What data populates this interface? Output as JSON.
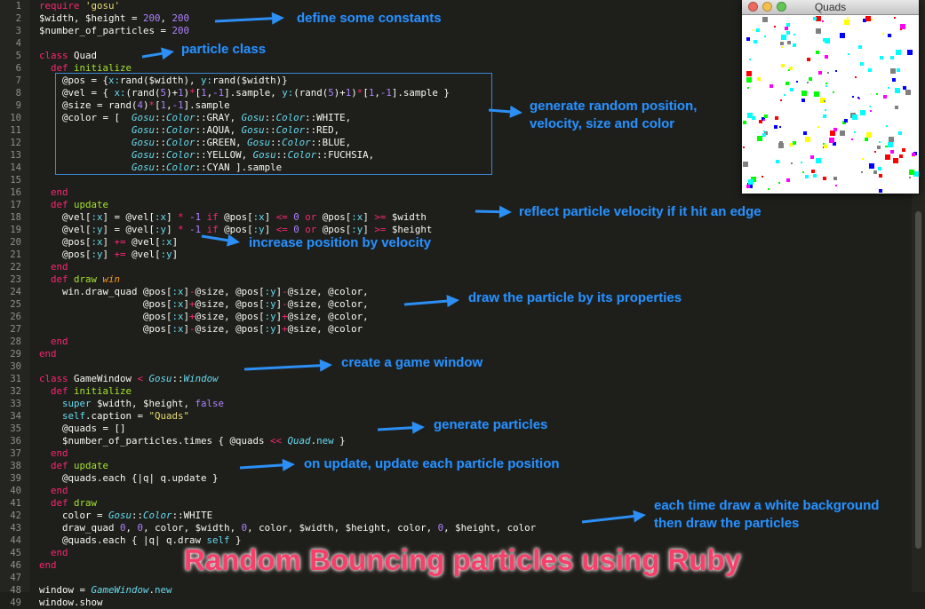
{
  "code_lines": [
    [
      [
        "kw",
        "require "
      ],
      [
        "str",
        "'gosu'"
      ]
    ],
    [
      [
        "iv",
        "$width, $height = "
      ],
      [
        "num",
        "200"
      ],
      [
        "iv",
        ", "
      ],
      [
        "num",
        "200"
      ]
    ],
    [
      [
        "iv",
        "$number_of_particles = "
      ],
      [
        "num",
        "200"
      ]
    ],
    [
      [
        "iv",
        ""
      ]
    ],
    [
      [
        "kw",
        "class "
      ],
      [
        "iv",
        "Quad"
      ]
    ],
    [
      [
        "iv",
        "  "
      ],
      [
        "kw",
        "def "
      ],
      [
        "fn",
        "initialize"
      ]
    ],
    [
      [
        "iv",
        "    @pos = {"
      ],
      [
        "sym",
        "x:"
      ],
      [
        "iv",
        "rand($width), "
      ],
      [
        "sym",
        "y:"
      ],
      [
        "iv",
        "rand($width)}"
      ]
    ],
    [
      [
        "iv",
        "    @vel = { "
      ],
      [
        "sym",
        "x:"
      ],
      [
        "iv",
        "(rand("
      ],
      [
        "num",
        "5"
      ],
      [
        "iv",
        ")+"
      ],
      [
        "num",
        "1"
      ],
      [
        "iv",
        ")"
      ],
      [
        "kw",
        "*"
      ],
      [
        "iv",
        "["
      ],
      [
        "num",
        "1"
      ],
      [
        "iv",
        ","
      ],
      [
        "num",
        "-1"
      ],
      [
        "iv",
        "].sample, "
      ],
      [
        "sym",
        "y:"
      ],
      [
        "iv",
        "(rand("
      ],
      [
        "num",
        "5"
      ],
      [
        "iv",
        ")+"
      ],
      [
        "num",
        "1"
      ],
      [
        "iv",
        ")"
      ],
      [
        "kw",
        "*"
      ],
      [
        "iv",
        "["
      ],
      [
        "num",
        "1"
      ],
      [
        "iv",
        ","
      ],
      [
        "num",
        "-1"
      ],
      [
        "iv",
        "].sample }"
      ]
    ],
    [
      [
        "iv",
        "    @size = rand("
      ],
      [
        "num",
        "4"
      ],
      [
        "iv",
        ")"
      ],
      [
        "kw",
        "*"
      ],
      [
        "iv",
        "["
      ],
      [
        "num",
        "1"
      ],
      [
        "iv",
        ","
      ],
      [
        "num",
        "-1"
      ],
      [
        "iv",
        "].sample"
      ]
    ],
    [
      [
        "iv",
        "    @color = [  "
      ],
      [
        "cn",
        "Gosu"
      ],
      [
        "iv",
        "::"
      ],
      [
        "cn",
        "Color"
      ],
      [
        "iv",
        "::GRAY, "
      ],
      [
        "cn",
        "Gosu"
      ],
      [
        "iv",
        "::"
      ],
      [
        "cn",
        "Color"
      ],
      [
        "iv",
        "::WHITE,"
      ]
    ],
    [
      [
        "iv",
        "                "
      ],
      [
        "cn",
        "Gosu"
      ],
      [
        "iv",
        "::"
      ],
      [
        "cn",
        "Color"
      ],
      [
        "iv",
        "::AQUA, "
      ],
      [
        "cn",
        "Gosu"
      ],
      [
        "iv",
        "::"
      ],
      [
        "cn",
        "Color"
      ],
      [
        "iv",
        "::RED,"
      ]
    ],
    [
      [
        "iv",
        "                "
      ],
      [
        "cn",
        "Gosu"
      ],
      [
        "iv",
        "::"
      ],
      [
        "cn",
        "Color"
      ],
      [
        "iv",
        "::GREEN, "
      ],
      [
        "cn",
        "Gosu"
      ],
      [
        "iv",
        "::"
      ],
      [
        "cn",
        "Color"
      ],
      [
        "iv",
        "::BLUE,"
      ]
    ],
    [
      [
        "iv",
        "                "
      ],
      [
        "cn",
        "Gosu"
      ],
      [
        "iv",
        "::"
      ],
      [
        "cn",
        "Color"
      ],
      [
        "iv",
        "::YELLOW, "
      ],
      [
        "cn",
        "Gosu"
      ],
      [
        "iv",
        "::"
      ],
      [
        "cn",
        "Color"
      ],
      [
        "iv",
        "::FUCHSIA,"
      ]
    ],
    [
      [
        "iv",
        "                "
      ],
      [
        "cn",
        "Gosu"
      ],
      [
        "iv",
        "::"
      ],
      [
        "cn",
        "Color"
      ],
      [
        "iv",
        "::CYAN ].sample"
      ]
    ],
    [
      [
        "iv",
        ""
      ]
    ],
    [
      [
        "iv",
        "  "
      ],
      [
        "kw",
        "end"
      ]
    ],
    [
      [
        "iv",
        "  "
      ],
      [
        "kw",
        "def "
      ],
      [
        "fn",
        "update"
      ]
    ],
    [
      [
        "iv",
        "    @vel["
      ],
      [
        "sym",
        ":x"
      ],
      [
        "iv",
        "] = @vel["
      ],
      [
        "sym",
        ":x"
      ],
      [
        "iv",
        "] "
      ],
      [
        "kw",
        "*"
      ],
      [
        "iv",
        " "
      ],
      [
        "num",
        "-1"
      ],
      [
        "iv",
        " "
      ],
      [
        "kw",
        "if"
      ],
      [
        "iv",
        " @pos["
      ],
      [
        "sym",
        ":x"
      ],
      [
        "iv",
        "] "
      ],
      [
        "kw",
        "<="
      ],
      [
        "iv",
        " "
      ],
      [
        "num",
        "0"
      ],
      [
        "iv",
        " "
      ],
      [
        "kw",
        "or"
      ],
      [
        "iv",
        " @pos["
      ],
      [
        "sym",
        ":x"
      ],
      [
        "iv",
        "] "
      ],
      [
        "kw",
        ">="
      ],
      [
        "iv",
        " $width"
      ]
    ],
    [
      [
        "iv",
        "    @vel["
      ],
      [
        "sym",
        ":y"
      ],
      [
        "iv",
        "] = @vel["
      ],
      [
        "sym",
        ":y"
      ],
      [
        "iv",
        "] "
      ],
      [
        "kw",
        "*"
      ],
      [
        "iv",
        " "
      ],
      [
        "num",
        "-1"
      ],
      [
        "iv",
        " "
      ],
      [
        "kw",
        "if"
      ],
      [
        "iv",
        " @pos["
      ],
      [
        "sym",
        ":y"
      ],
      [
        "iv",
        "] "
      ],
      [
        "kw",
        "<="
      ],
      [
        "iv",
        " "
      ],
      [
        "num",
        "0"
      ],
      [
        "iv",
        " "
      ],
      [
        "kw",
        "or"
      ],
      [
        "iv",
        " @pos["
      ],
      [
        "sym",
        ":y"
      ],
      [
        "iv",
        "] "
      ],
      [
        "kw",
        ">="
      ],
      [
        "iv",
        " $height"
      ]
    ],
    [
      [
        "iv",
        "    @pos["
      ],
      [
        "sym",
        ":x"
      ],
      [
        "iv",
        "] "
      ],
      [
        "kw",
        "+="
      ],
      [
        "iv",
        " @vel["
      ],
      [
        "sym",
        ":x"
      ],
      [
        "iv",
        "]"
      ]
    ],
    [
      [
        "iv",
        "    @pos["
      ],
      [
        "sym",
        ":y"
      ],
      [
        "iv",
        "] "
      ],
      [
        "kw",
        "+="
      ],
      [
        "iv",
        " @vel["
      ],
      [
        "sym",
        ":y"
      ],
      [
        "iv",
        "]"
      ]
    ],
    [
      [
        "iv",
        "  "
      ],
      [
        "kw",
        "end"
      ]
    ],
    [
      [
        "iv",
        "  "
      ],
      [
        "kw",
        "def "
      ],
      [
        "fn",
        "draw "
      ],
      [
        "pm",
        "win"
      ]
    ],
    [
      [
        "iv",
        "    win.draw_quad @pos["
      ],
      [
        "sym",
        ":x"
      ],
      [
        "iv",
        "]"
      ],
      [
        "kw",
        "-"
      ],
      [
        "iv",
        "@size, @pos["
      ],
      [
        "sym",
        ":y"
      ],
      [
        "iv",
        "]"
      ],
      [
        "kw",
        "-"
      ],
      [
        "iv",
        "@size, @color,"
      ]
    ],
    [
      [
        "iv",
        "                  @pos["
      ],
      [
        "sym",
        ":x"
      ],
      [
        "iv",
        "]"
      ],
      [
        "kw",
        "+"
      ],
      [
        "iv",
        "@size, @pos["
      ],
      [
        "sym",
        ":y"
      ],
      [
        "iv",
        "]"
      ],
      [
        "kw",
        "-"
      ],
      [
        "iv",
        "@size, @color,"
      ]
    ],
    [
      [
        "iv",
        "                  @pos["
      ],
      [
        "sym",
        ":x"
      ],
      [
        "iv",
        "]"
      ],
      [
        "kw",
        "+"
      ],
      [
        "iv",
        "@size, @pos["
      ],
      [
        "sym",
        ":y"
      ],
      [
        "iv",
        "]"
      ],
      [
        "kw",
        "+"
      ],
      [
        "iv",
        "@size, @color,"
      ]
    ],
    [
      [
        "iv",
        "                  @pos["
      ],
      [
        "sym",
        ":x"
      ],
      [
        "iv",
        "]"
      ],
      [
        "kw",
        "-"
      ],
      [
        "iv",
        "@size, @pos["
      ],
      [
        "sym",
        ":y"
      ],
      [
        "iv",
        "]"
      ],
      [
        "kw",
        "+"
      ],
      [
        "iv",
        "@size, @color"
      ]
    ],
    [
      [
        "iv",
        "  "
      ],
      [
        "kw",
        "end"
      ]
    ],
    [
      [
        "kw",
        "end"
      ]
    ],
    [
      [
        "iv",
        ""
      ]
    ],
    [
      [
        "kw",
        "class "
      ],
      [
        "iv",
        "GameWindow "
      ],
      [
        "kw",
        "< "
      ],
      [
        "cn",
        "Gosu"
      ],
      [
        "iv",
        "::"
      ],
      [
        "cn",
        "Window"
      ]
    ],
    [
      [
        "iv",
        "  "
      ],
      [
        "kw",
        "def "
      ],
      [
        "fn",
        "initialize"
      ]
    ],
    [
      [
        "iv",
        "    "
      ],
      [
        "fnc",
        "super"
      ],
      [
        "iv",
        " $width, $height, "
      ],
      [
        "num",
        "false"
      ]
    ],
    [
      [
        "iv",
        "    "
      ],
      [
        "fnc",
        "self"
      ],
      [
        "iv",
        ".caption = "
      ],
      [
        "str",
        "\"Quads\""
      ]
    ],
    [
      [
        "iv",
        "    @quads = []"
      ]
    ],
    [
      [
        "iv",
        "    $number_of_particles.times { @quads "
      ],
      [
        "kw",
        "<<"
      ],
      [
        "iv",
        " "
      ],
      [
        "cn",
        "Quad"
      ],
      [
        "iv",
        "."
      ],
      [
        "fnc",
        "new"
      ],
      [
        "iv",
        " }"
      ]
    ],
    [
      [
        "iv",
        "  "
      ],
      [
        "kw",
        "end"
      ]
    ],
    [
      [
        "iv",
        "  "
      ],
      [
        "kw",
        "def "
      ],
      [
        "fn",
        "update"
      ]
    ],
    [
      [
        "iv",
        "    @quads.each {|q| q.update }"
      ]
    ],
    [
      [
        "iv",
        "  "
      ],
      [
        "kw",
        "end"
      ]
    ],
    [
      [
        "iv",
        "  "
      ],
      [
        "kw",
        "def "
      ],
      [
        "fn",
        "draw"
      ]
    ],
    [
      [
        "iv",
        "    color = "
      ],
      [
        "cn",
        "Gosu"
      ],
      [
        "iv",
        "::"
      ],
      [
        "cn",
        "Color"
      ],
      [
        "iv",
        "::WHITE"
      ]
    ],
    [
      [
        "iv",
        "    draw_quad "
      ],
      [
        "num",
        "0"
      ],
      [
        "iv",
        ", "
      ],
      [
        "num",
        "0"
      ],
      [
        "iv",
        ", color, $width, "
      ],
      [
        "num",
        "0"
      ],
      [
        "iv",
        ", color, $width, $height, color, "
      ],
      [
        "num",
        "0"
      ],
      [
        "iv",
        ", $height, color"
      ]
    ],
    [
      [
        "iv",
        "    @quads.each { |q| q.draw "
      ],
      [
        "fnc",
        "self"
      ],
      [
        "iv",
        " }"
      ]
    ],
    [
      [
        "iv",
        "  "
      ],
      [
        "kw",
        "end"
      ]
    ],
    [
      [
        "kw",
        "end"
      ]
    ],
    [
      [
        "iv",
        ""
      ]
    ],
    [
      [
        "iv",
        "window = "
      ],
      [
        "cn",
        "GameWindow"
      ],
      [
        "iv",
        "."
      ],
      [
        "fnc",
        "new"
      ]
    ],
    [
      [
        "iv",
        "window.show"
      ]
    ]
  ],
  "annotations": [
    {
      "text": "define some constants"
    },
    {
      "text": "particle class"
    },
    {
      "text": "generate random position,\nvelocity, size and color"
    },
    {
      "text": "reflect particle velocity if it hit an edge"
    },
    {
      "text": "increase position by velocity"
    },
    {
      "text": "draw the particle by its properties"
    },
    {
      "text": "create a game window"
    },
    {
      "text": "generate particles"
    },
    {
      "text": "on update, update each particle position"
    },
    {
      "text": "each time draw a white background\nthen draw the particles"
    }
  ],
  "window": {
    "title": "Quads",
    "traffic_lights": [
      "#ed6a5e",
      "#f5bf4f",
      "#62c554"
    ],
    "particle_colors": [
      "#808080",
      "#00ffff",
      "#ff0000",
      "#00ff00",
      "#0000ff",
      "#ffff00",
      "#ff00ff",
      "#00ffff",
      "#ffffff"
    ]
  },
  "title": "Random Bouncing particles using Ruby",
  "colors": {
    "annotation": "#2c8ff5",
    "title": "#f5406a",
    "highlight_box": "#3a87d8"
  }
}
